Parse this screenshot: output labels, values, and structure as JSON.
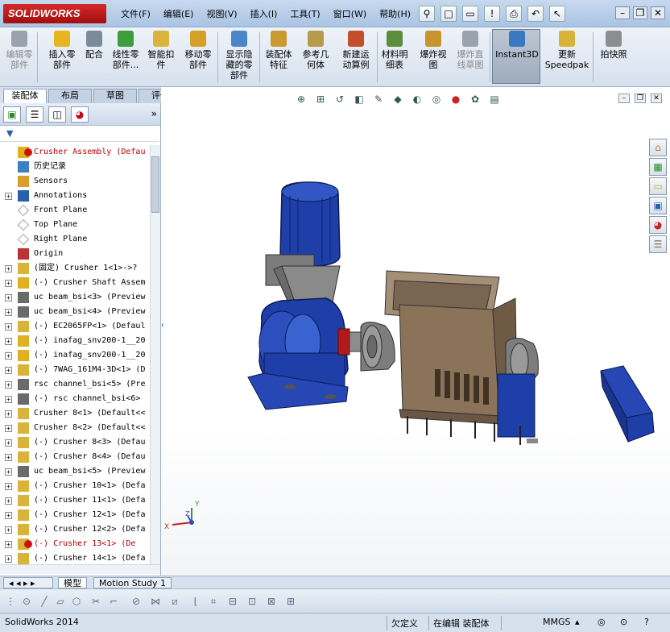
{
  "app": {
    "logo_text": "SOLIDWORKS"
  },
  "menu": [
    "文件(F)",
    "编辑(E)",
    "视图(V)",
    "插入(I)",
    "工具(T)",
    "窗口(W)",
    "帮助(H)"
  ],
  "quick_access": [
    "pin-icon",
    "new-icon",
    "open-icon",
    "rebuild-icon",
    "print-icon",
    "undo-icon",
    "select-icon"
  ],
  "ribbon": {
    "buttons": [
      {
        "label": "编辑零\n部件",
        "icon": "edit-part-icon",
        "color": "#9aa3ad",
        "disabled": true
      },
      {
        "label": "插入零\n部件",
        "icon": "insert-component-icon",
        "color": "#e6b520"
      },
      {
        "label": "配合",
        "icon": "mate-icon",
        "color": "#7a8b9b"
      },
      {
        "label": "线性零\n部件...",
        "icon": "linear-pattern-icon",
        "color": "#3f9c3b"
      },
      {
        "label": "智能扣\n件",
        "icon": "smart-fasteners-icon",
        "color": "#d9b33a"
      },
      {
        "label": "移动零\n部件",
        "icon": "move-component-icon",
        "color": "#d6a028"
      },
      {
        "label": "显示隐\n藏的零\n部件",
        "icon": "show-hidden-icon",
        "color": "#4a86c9"
      },
      {
        "label": "装配体\n特征",
        "icon": "assembly-features-icon",
        "color": "#c99b2e"
      },
      {
        "label": "参考几\n何体",
        "icon": "reference-geometry-icon",
        "color": "#b99a4d"
      },
      {
        "label": "新建运\n动算例",
        "icon": "new-motion-study-icon",
        "color": "#c44e2a"
      },
      {
        "label": "材料明\n细表",
        "icon": "bom-icon",
        "color": "#5c8d3a"
      },
      {
        "label": "爆炸视\n图",
        "icon": "exploded-view-icon",
        "color": "#c9932d"
      },
      {
        "label": "爆炸直\n线草图",
        "icon": "explode-line-icon",
        "color": "#9aa3ad",
        "disabled": true
      },
      {
        "label": "Instant3D",
        "icon": "instant3d-icon",
        "color": "#3a78c2"
      },
      {
        "label": "更新\nSpeedpak",
        "icon": "speedpak-icon",
        "color": "#d8b23a"
      },
      {
        "label": "拍快照",
        "icon": "snapshot-icon",
        "color": "#8d8d8d"
      }
    ]
  },
  "tabs": [
    "装配体",
    "布局",
    "草图",
    "评估"
  ],
  "tree": [
    {
      "text": "Crusher Assembly  (Defau",
      "type": "assembly",
      "error": true,
      "expander": ""
    },
    {
      "text": "历史记录",
      "type": "folder",
      "expander": ""
    },
    {
      "text": "Sensors",
      "type": "sensor",
      "expander": ""
    },
    {
      "text": "Annotations",
      "type": "annotation",
      "expander": "+"
    },
    {
      "text": "Front Plane",
      "type": "plane",
      "expander": ""
    },
    {
      "text": "Top Plane",
      "type": "plane",
      "expander": ""
    },
    {
      "text": "Right Plane",
      "type": "plane",
      "expander": ""
    },
    {
      "text": "Origin",
      "type": "origin",
      "expander": ""
    },
    {
      "text": "(固定) Crusher 1<1>->?",
      "type": "part",
      "expander": "+"
    },
    {
      "text": "(-) Crusher Shaft Assem",
      "type": "assembly",
      "expander": "+"
    },
    {
      "text": "uc beam_bsi<3> (Preview",
      "type": "toolbox",
      "expander": "+"
    },
    {
      "text": "uc beam_bsi<4> (Preview",
      "type": "toolbox",
      "expander": "+"
    },
    {
      "text": "(-) EC2065FP<1> (Defaul",
      "type": "part",
      "expander": "+"
    },
    {
      "text": "(-) inafag_snv200-1__20",
      "type": "assembly",
      "expander": "+"
    },
    {
      "text": "(-) inafag_snv200-1__20",
      "type": "assembly",
      "expander": "+"
    },
    {
      "text": "(-) 7WAG_161M4-3D<1> (D",
      "type": "part",
      "expander": "+"
    },
    {
      "text": "rsc channel_bsi<5> (Pre",
      "type": "toolbox",
      "expander": "+"
    },
    {
      "text": "(-) rsc channel_bsi<6>",
      "type": "toolbox",
      "expander": "+"
    },
    {
      "text": "Crusher 8<1> (Default<<",
      "type": "part",
      "expander": "+"
    },
    {
      "text": "Crusher 8<2> (Default<<",
      "type": "part",
      "expander": "+"
    },
    {
      "text": "(-) Crusher 8<3> (Defau",
      "type": "part",
      "expander": "+"
    },
    {
      "text": "(-) Crusher 8<4> (Defau",
      "type": "part",
      "expander": "+"
    },
    {
      "text": "uc beam_bsi<5> (Preview",
      "type": "toolbox",
      "expander": "+"
    },
    {
      "text": "(-) Crusher 10<1> (Defa",
      "type": "part",
      "expander": "+"
    },
    {
      "text": "(-) Crusher 11<1> (Defa",
      "type": "part",
      "expander": "+"
    },
    {
      "text": "(-) Crusher 12<1> (Defa",
      "type": "part",
      "expander": "+"
    },
    {
      "text": "(-) Crusher 12<2> (Defa",
      "type": "part",
      "expander": "+"
    },
    {
      "text": "(-) Crusher 13<1> (De",
      "type": "part",
      "error": true,
      "expander": "+"
    },
    {
      "text": "(-) Crusher 14<1> (Defa",
      "type": "part",
      "expander": "+"
    }
  ],
  "viewport": {
    "triad": {
      "x_label": "X",
      "y_label": "Y",
      "z_label": "Z"
    }
  },
  "bottom_tabs": [
    "模型",
    "Motion Study 1"
  ],
  "status": {
    "app_version": "SolidWorks 2014",
    "definition": "欠定义",
    "mode": "在编辑 装配体",
    "units": "MMGS"
  },
  "colors": {
    "motor_blue": "#1f3fa8",
    "gear_red": "#b41818",
    "housing_tan": "#8b7359",
    "bearing_gray": "#7d7d7d"
  }
}
